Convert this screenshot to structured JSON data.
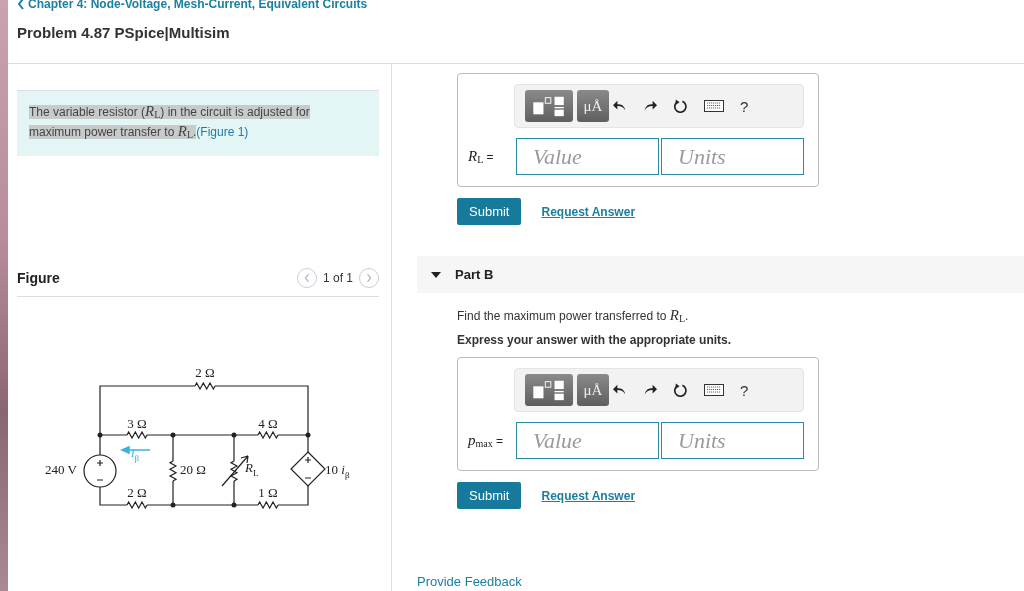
{
  "breadcrumb": "Chapter 4: Node-Voltage, Mesh-Current, Equivalent Circuits",
  "title": "Problem 4.87 PSpice|Multisim",
  "intro": {
    "text": "The variable resistor (*R*$_{L}$) in the circuit is adjusted for maximum power transfer to *R*$_{L}$.",
    "link": "(Figure 1)",
    "selected": true
  },
  "figure": {
    "label": "Figure",
    "pager": "1 of 1",
    "circuit_labels": [
      "2 Ω",
      "3 Ω",
      "4 Ω",
      "*i*$_{β}$",
      "240 V",
      "20 Ω",
      "*R*$_{L}$",
      "10 *i*$_{β}$",
      "2 Ω",
      "1 Ω"
    ]
  },
  "part_a": {
    "answer": {
      "label": "*R*$_{L}$ =",
      "value_placeholder": "Value",
      "units_placeholder": "Units",
      "units_button": "μÅ",
      "help": "?"
    },
    "submit": "Submit",
    "request": "Request Answer"
  },
  "part_b": {
    "title": "Part B",
    "expanded": true,
    "prompt": "Find the maximum power transferred to *R*$_{L}$.",
    "instruction": "Express your answer with the appropriate units.",
    "answer": {
      "label": "*p*$_{max}$ =",
      "value_placeholder": "Value",
      "units_placeholder": "Units",
      "units_button": "μÅ",
      "help": "?"
    },
    "submit": "Submit",
    "request": "Request Answer"
  },
  "feedback": "Provide Feedback"
}
